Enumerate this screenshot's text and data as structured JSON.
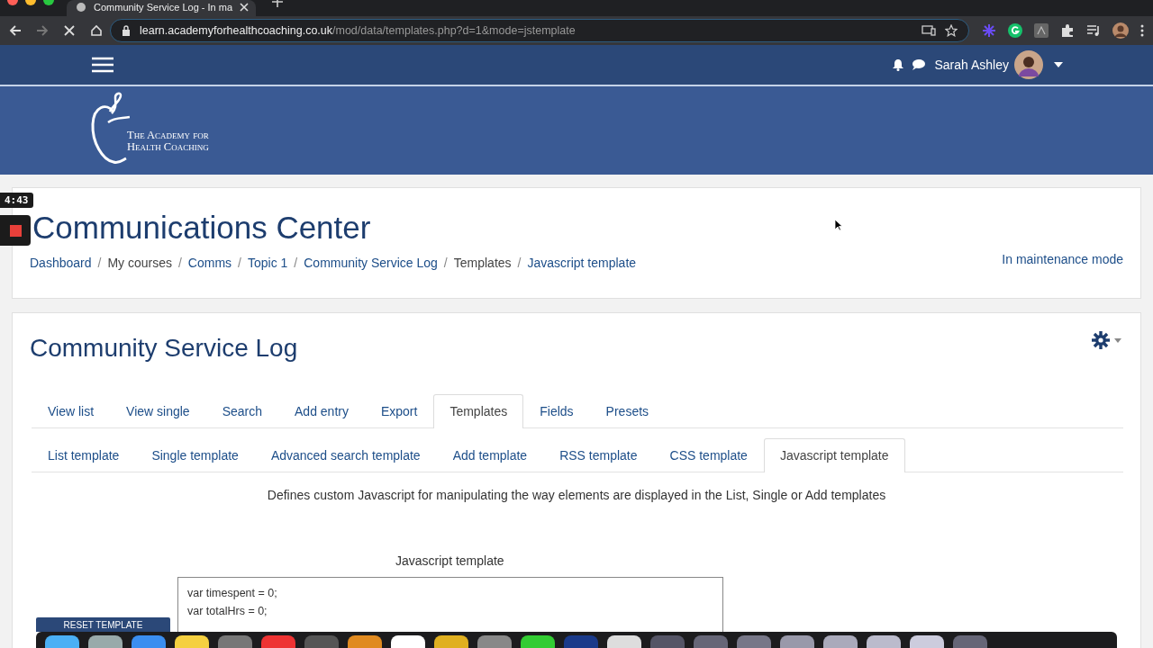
{
  "browser": {
    "tab_title": "Community Service Log - In ma",
    "url_host": "learn.academyforhealthcoaching.co.uk",
    "url_path": "/mod/data/templates.php?d=1&mode=jstemplate"
  },
  "navbar": {
    "user_name": "Sarah Ashley"
  },
  "brand": {
    "line_1": "The Academy for",
    "line_2": "Health Coaching"
  },
  "recorder": {
    "time": "4:43"
  },
  "page_header": {
    "title": "Communications Center",
    "status": "In maintenance mode",
    "separator": "/",
    "breadcrumbs": [
      {
        "label": "Dashboard",
        "link": true
      },
      {
        "label": "My courses",
        "link": false
      },
      {
        "label": "Comms",
        "link": true
      },
      {
        "label": "Topic 1",
        "link": true
      },
      {
        "label": "Community Service Log",
        "link": true
      },
      {
        "label": "Templates",
        "link": false
      },
      {
        "label": "Javascript template",
        "link": true
      }
    ]
  },
  "activity": {
    "title": "Community Service Log",
    "tabs": [
      {
        "label": "View list",
        "selected": false
      },
      {
        "label": "View single",
        "selected": false
      },
      {
        "label": "Search",
        "selected": false
      },
      {
        "label": "Add entry",
        "selected": false
      },
      {
        "label": "Export",
        "selected": false
      },
      {
        "label": "Templates",
        "selected": true
      },
      {
        "label": "Fields",
        "selected": false
      },
      {
        "label": "Presets",
        "selected": false
      }
    ],
    "subtabs": [
      {
        "label": "List template",
        "selected": false
      },
      {
        "label": "Single template",
        "selected": false
      },
      {
        "label": "Advanced search template",
        "selected": false
      },
      {
        "label": "Add template",
        "selected": false
      },
      {
        "label": "RSS template",
        "selected": false
      },
      {
        "label": "CSS template",
        "selected": false
      },
      {
        "label": "Javascript template",
        "selected": true
      }
    ],
    "description": "Defines custom Javascript for manipulating the way elements are displayed in the List, Single or Add templates",
    "editor_label": "Javascript template",
    "code_lines": [
      "var timespent = 0;",
      "var totalHrs = 0;"
    ],
    "reset_button": "RESET TEMPLATE"
  }
}
